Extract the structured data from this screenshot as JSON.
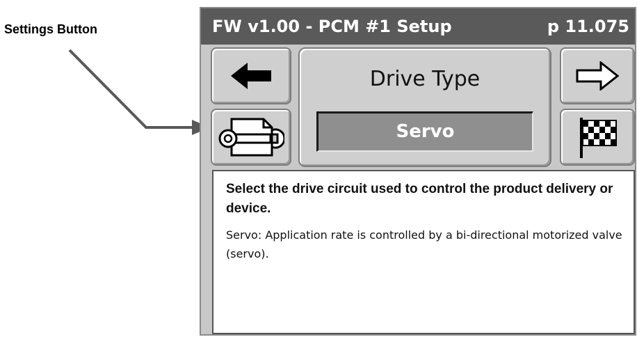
{
  "annotation": {
    "label": "Settings Button"
  },
  "titlebar": {
    "left": "FW v1.00 - PCM #1 Setup",
    "right": "p 11.075"
  },
  "icons": {
    "back": "left-arrow-icon",
    "next": "right-arrow-icon",
    "settings": "wrench-document-icon",
    "finish": "checkered-flag-icon"
  },
  "setting": {
    "name": "Drive Type",
    "value": "Servo"
  },
  "description": {
    "heading": "Select the drive circuit used to control the product delivery or device.",
    "body": "Servo: Application rate is controlled by a bi-directional motorized valve (servo)."
  },
  "colors": {
    "titlebar_bg": "#5a5a5a",
    "screen_bg": "#c8c8c8",
    "value_field_bg": "#8f8f8f"
  }
}
